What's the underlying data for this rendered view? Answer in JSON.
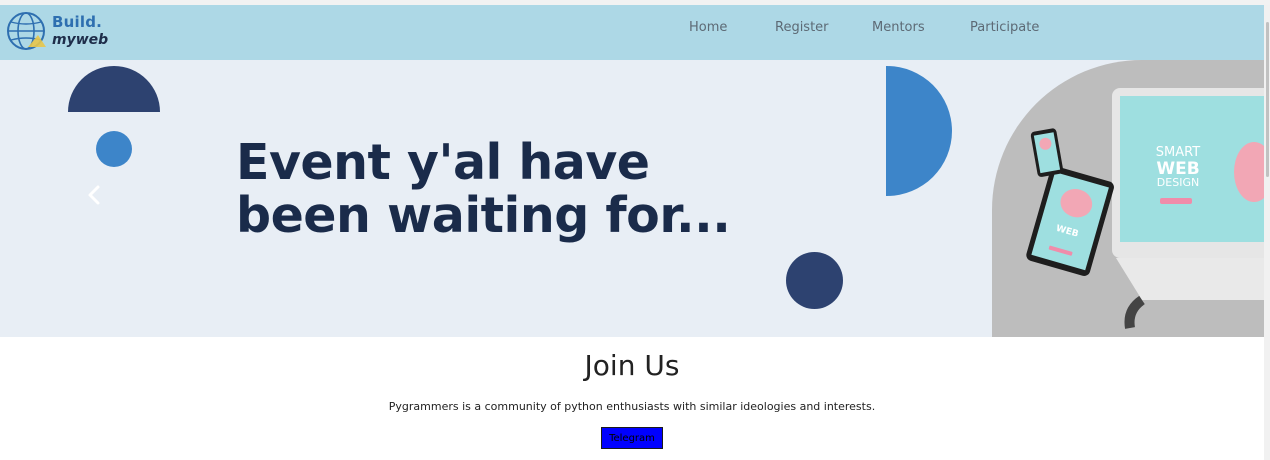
{
  "logo": {
    "line1": "Build.",
    "line2": "myweb"
  },
  "nav": {
    "links": [
      {
        "label": "Home"
      },
      {
        "label": "Register"
      },
      {
        "label": "Mentors"
      },
      {
        "label": "Participate"
      }
    ]
  },
  "hero": {
    "title": "Event y'al have been waiting for...",
    "image_text": {
      "line1": "SMART",
      "line2": "WEB",
      "line3": "DESIGN"
    }
  },
  "join": {
    "title": "Join Us",
    "text": "Pygrammers is a community of python enthusiasts with similar ideologies and interests.",
    "button_label": "Telegram"
  },
  "colors": {
    "navbar": "#add8e6",
    "hero_bg": "#e8eef5",
    "navy": "#2d4270",
    "blue": "#3d85c9",
    "title": "#1a2b4a",
    "button": "#0000ff"
  }
}
